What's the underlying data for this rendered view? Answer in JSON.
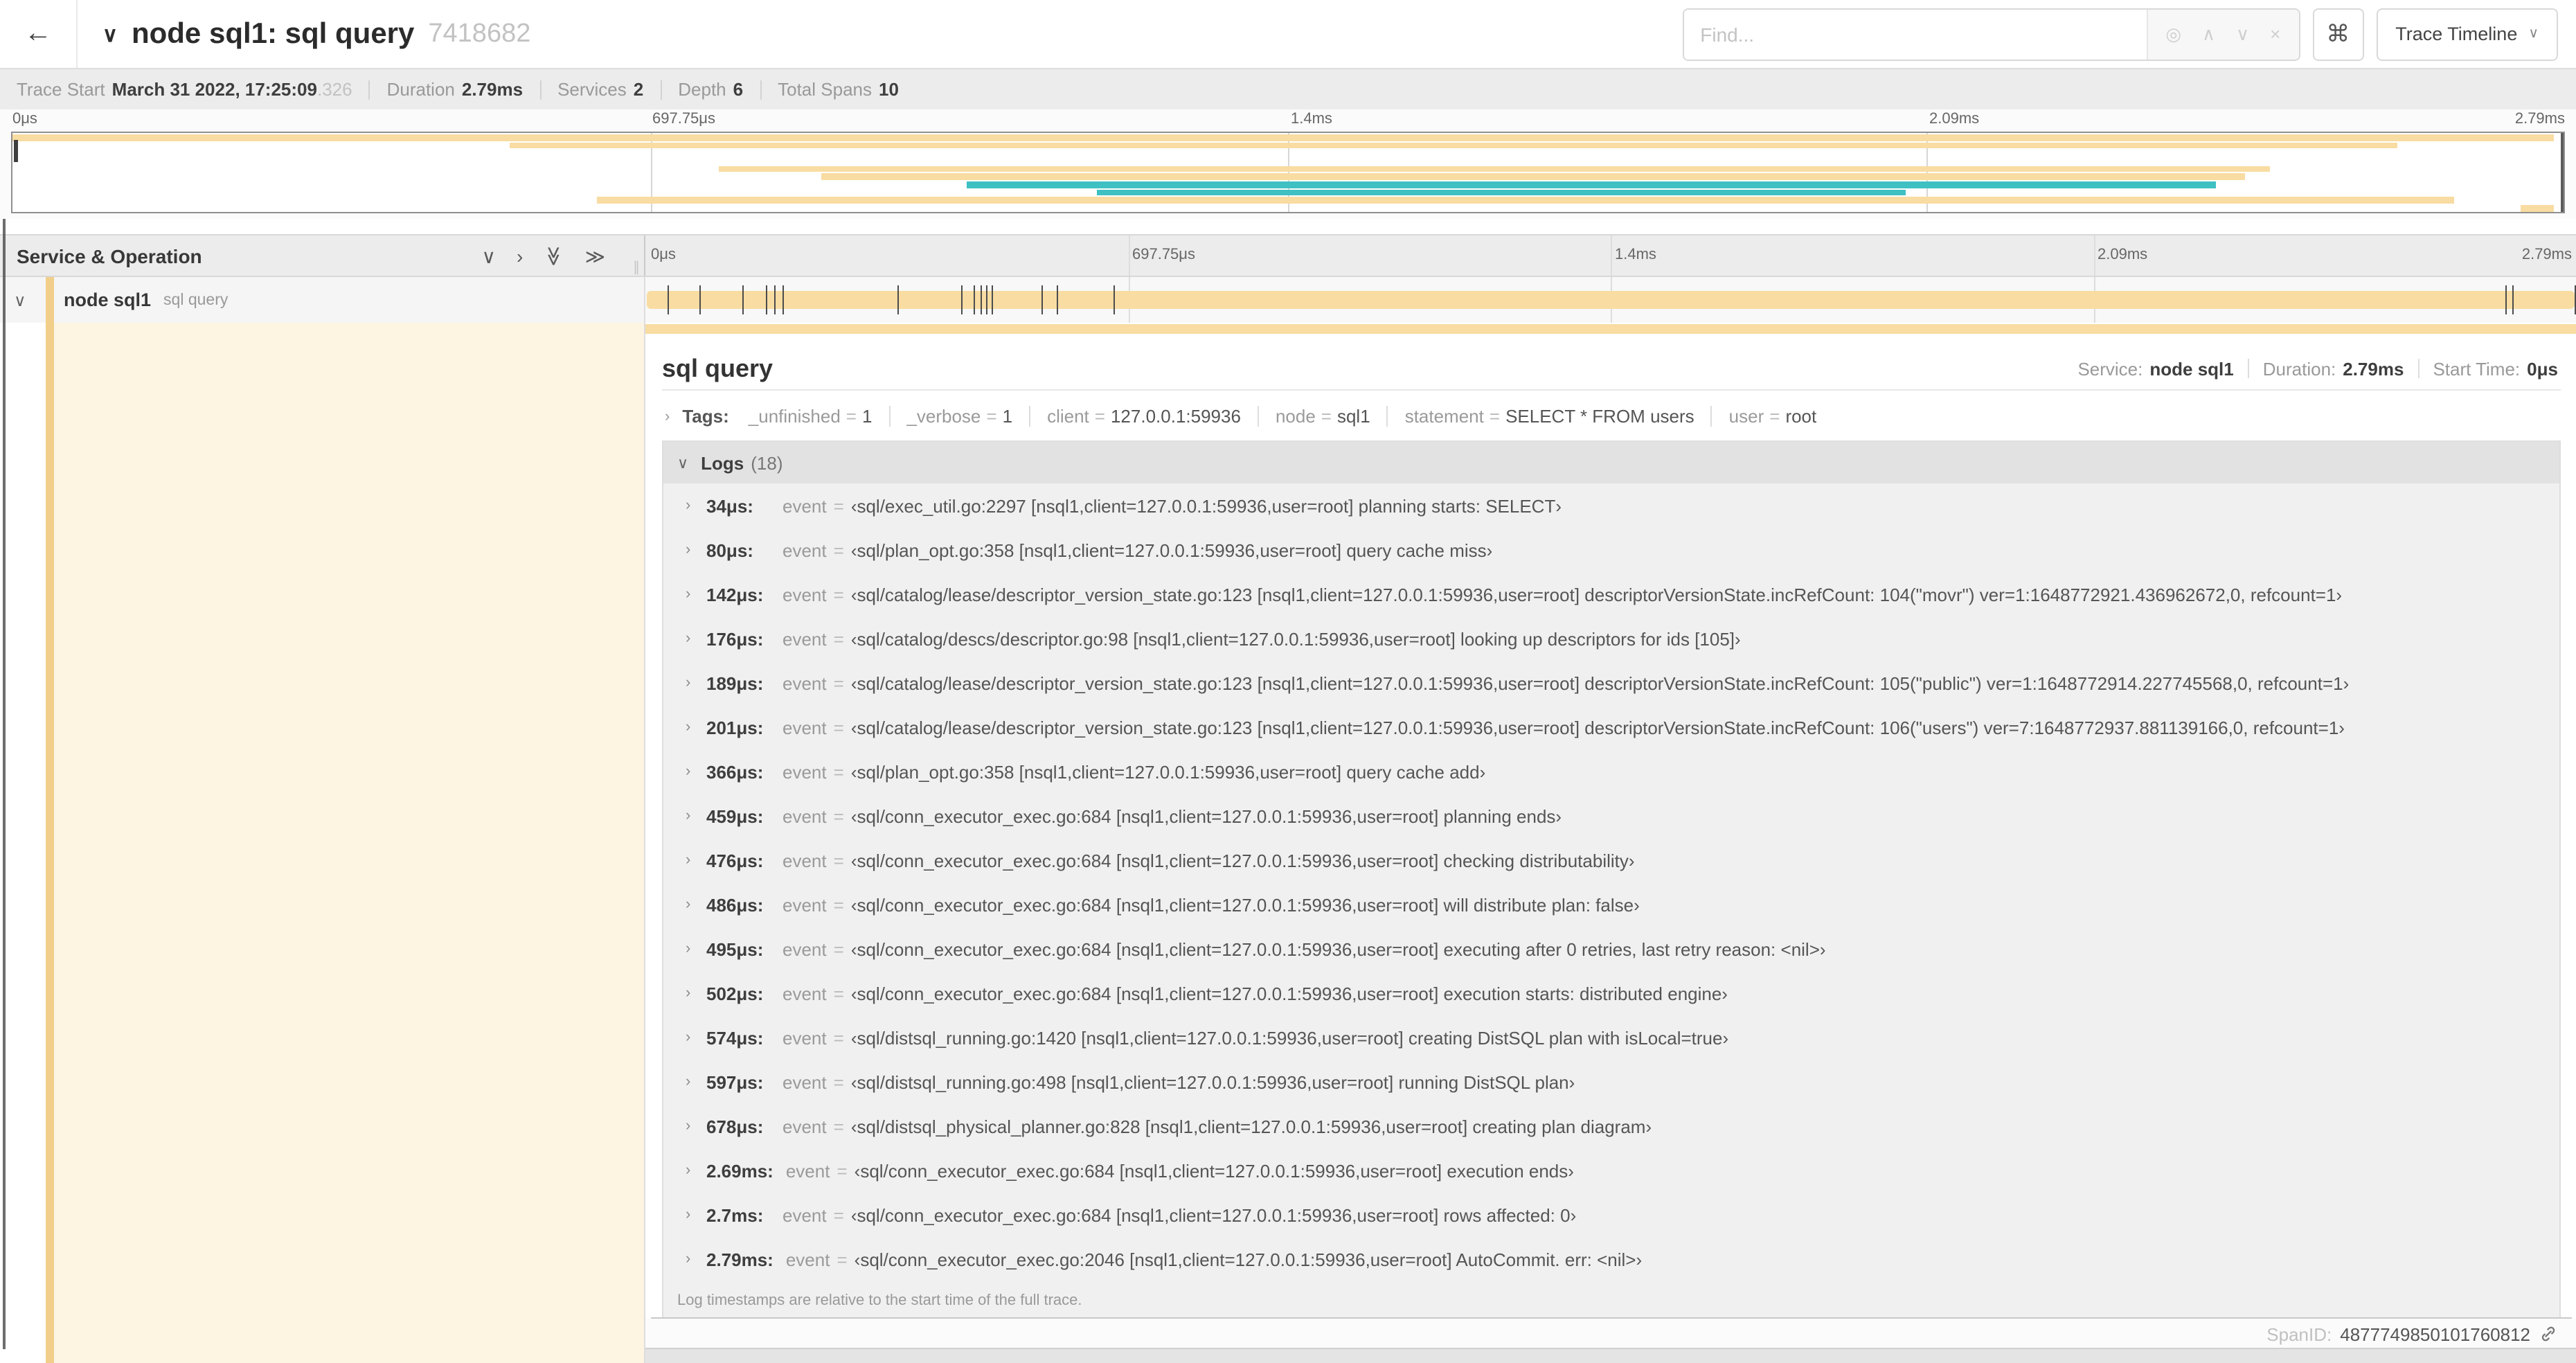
{
  "colors": {
    "span_bar": "#f8dca2",
    "span_accent": "#f1cf8b",
    "detail_bg": "#fdf5e2",
    "teal": "#3fc0c3"
  },
  "topbar": {
    "back_icon": "←",
    "collapse_icon": "∨",
    "title": "node sql1: sql query",
    "trace_id": "7418682",
    "find_placeholder": "Find...",
    "find_icons": [
      {
        "glyph": "◎",
        "name": "locate-icon"
      },
      {
        "glyph": "∧",
        "name": "find-prev-icon"
      },
      {
        "glyph": "∨",
        "name": "find-next-icon"
      },
      {
        "glyph": "×",
        "name": "clear-find-icon"
      }
    ],
    "keyboard_button": "⌘",
    "view_button": "Trace Timeline",
    "view_chevron": "∨"
  },
  "stats": [
    {
      "label": "Trace Start",
      "value": "March 31 2022, 17:25:09",
      "suffix": ".326"
    },
    {
      "label": "Duration",
      "value": "2.79ms"
    },
    {
      "label": "Services",
      "value": "2"
    },
    {
      "label": "Depth",
      "value": "6"
    },
    {
      "label": "Total Spans",
      "value": "10"
    }
  ],
  "ruler": [
    {
      "label": "0μs",
      "pct": 0
    },
    {
      "label": "697.75μs",
      "pct": 25
    },
    {
      "label": "1.4ms",
      "pct": 50
    },
    {
      "label": "2.09ms",
      "pct": 75
    },
    {
      "label": "2.79ms",
      "pct": 100
    }
  ],
  "trace": {
    "duration_us": 2791
  },
  "minimap": {
    "rows": 10,
    "bars": [
      {
        "row": 0,
        "start": 0,
        "end": 99.6,
        "color": "tan"
      },
      {
        "row": 1,
        "start": 19.5,
        "end": 93.5,
        "color": "tan"
      },
      {
        "row": 4,
        "start": 27.7,
        "end": 88.5,
        "color": "tan"
      },
      {
        "row": 5,
        "start": 31.7,
        "end": 87.5,
        "color": "tan"
      },
      {
        "row": 6,
        "start": 37.4,
        "end": 86.4,
        "color": "teal"
      },
      {
        "row": 7,
        "start": 42.5,
        "end": 74.2,
        "color": "teal"
      },
      {
        "row": 8,
        "start": 22.9,
        "end": 95.7,
        "color": "tan"
      },
      {
        "row": 9,
        "start": 98.3,
        "end": 99.6,
        "color": "tan"
      }
    ]
  },
  "timeline_header": {
    "label": "Service & Operation",
    "grip": "∥",
    "icons": [
      {
        "glyph": "∨",
        "name": "collapse-one-icon",
        "rotate": false
      },
      {
        "glyph": "›",
        "name": "expand-one-icon",
        "rotate": false
      },
      {
        "glyph": "≫",
        "name": "collapse-all-icon",
        "rotate": true
      },
      {
        "glyph": "≫",
        "name": "expand-all-icon",
        "rotate": false
      }
    ]
  },
  "span_row": {
    "chevron": "∨",
    "service": "node sql1",
    "operation": "sql query"
  },
  "detail": {
    "title": "sql query",
    "meta": [
      {
        "label": "Service:",
        "value": "node sql1"
      },
      {
        "label": "Duration:",
        "value": "2.79ms"
      },
      {
        "label": "Start Time:",
        "value": "0μs"
      }
    ],
    "tags_chevron": "›",
    "tags_label": "Tags:",
    "tags": [
      {
        "key": "_unfinished",
        "value": "1"
      },
      {
        "key": "_verbose",
        "value": "1"
      },
      {
        "key": "client",
        "value": "127.0.0.1:59936"
      },
      {
        "key": "node",
        "value": "sql1"
      },
      {
        "key": "statement",
        "value": "SELECT * FROM users"
      },
      {
        "key": "user",
        "value": "root"
      }
    ],
    "logs_chevron": "∨",
    "logs_label": "Logs",
    "logs_count": "(18)",
    "logs": [
      {
        "ts": "34μs:",
        "t_us": 34,
        "key": "event",
        "value": "‹sql/exec_util.go:2297 [nsql1,client=127.0.0.1:59936,user=root] planning starts: SELECT›"
      },
      {
        "ts": "80μs:",
        "t_us": 80,
        "key": "event",
        "value": "‹sql/plan_opt.go:358 [nsql1,client=127.0.0.1:59936,user=root] query cache miss›"
      },
      {
        "ts": "142μs:",
        "t_us": 142,
        "key": "event",
        "value": "‹sql/catalog/lease/descriptor_version_state.go:123 [nsql1,client=127.0.0.1:59936,user=root] descriptorVersionState.incRefCount: 104(\"movr\") ver=1:1648772921.436962672,0, refcount=1›"
      },
      {
        "ts": "176μs:",
        "t_us": 176,
        "key": "event",
        "value": "‹sql/catalog/descs/descriptor.go:98 [nsql1,client=127.0.0.1:59936,user=root] looking up descriptors for ids [105]›"
      },
      {
        "ts": "189μs:",
        "t_us": 189,
        "key": "event",
        "value": "‹sql/catalog/lease/descriptor_version_state.go:123 [nsql1,client=127.0.0.1:59936,user=root] descriptorVersionState.incRefCount: 105(\"public\") ver=1:1648772914.227745568,0, refcount=1›"
      },
      {
        "ts": "201μs:",
        "t_us": 201,
        "key": "event",
        "value": "‹sql/catalog/lease/descriptor_version_state.go:123 [nsql1,client=127.0.0.1:59936,user=root] descriptorVersionState.incRefCount: 106(\"users\") ver=7:1648772937.881139166,0, refcount=1›"
      },
      {
        "ts": "366μs:",
        "t_us": 366,
        "key": "event",
        "value": "‹sql/plan_opt.go:358 [nsql1,client=127.0.0.1:59936,user=root] query cache add›"
      },
      {
        "ts": "459μs:",
        "t_us": 459,
        "key": "event",
        "value": "‹sql/conn_executor_exec.go:684 [nsql1,client=127.0.0.1:59936,user=root] planning ends›"
      },
      {
        "ts": "476μs:",
        "t_us": 476,
        "key": "event",
        "value": "‹sql/conn_executor_exec.go:684 [nsql1,client=127.0.0.1:59936,user=root] checking distributability›"
      },
      {
        "ts": "486μs:",
        "t_us": 486,
        "key": "event",
        "value": "‹sql/conn_executor_exec.go:684 [nsql1,client=127.0.0.1:59936,user=root] will distribute plan: false›"
      },
      {
        "ts": "495μs:",
        "t_us": 495,
        "key": "event",
        "value": "‹sql/conn_executor_exec.go:684 [nsql1,client=127.0.0.1:59936,user=root] executing after 0 retries, last retry reason: <nil>›"
      },
      {
        "ts": "502μs:",
        "t_us": 502,
        "key": "event",
        "value": "‹sql/conn_executor_exec.go:684 [nsql1,client=127.0.0.1:59936,user=root] execution starts: distributed engine›"
      },
      {
        "ts": "574μs:",
        "t_us": 574,
        "key": "event",
        "value": "‹sql/distsql_running.go:1420 [nsql1,client=127.0.0.1:59936,user=root] creating DistSQL plan with isLocal=true›"
      },
      {
        "ts": "597μs:",
        "t_us": 597,
        "key": "event",
        "value": "‹sql/distsql_running.go:498 [nsql1,client=127.0.0.1:59936,user=root] running DistSQL plan›"
      },
      {
        "ts": "678μs:",
        "t_us": 678,
        "key": "event",
        "value": "‹sql/distsql_physical_planner.go:828 [nsql1,client=127.0.0.1:59936,user=root] creating plan diagram›"
      },
      {
        "ts": "2.69ms:",
        "t_us": 2690,
        "key": "event",
        "value": "‹sql/conn_executor_exec.go:684 [nsql1,client=127.0.0.1:59936,user=root] execution ends›"
      },
      {
        "ts": "2.7ms:",
        "t_us": 2700,
        "key": "event",
        "value": "‹sql/conn_executor_exec.go:684 [nsql1,client=127.0.0.1:59936,user=root] rows affected: 0›"
      },
      {
        "ts": "2.79ms:",
        "t_us": 2790,
        "key": "event",
        "value": "‹sql/conn_executor_exec.go:2046 [nsql1,client=127.0.0.1:59936,user=root] AutoCommit. err: <nil>›"
      }
    ],
    "note": "Log timestamps are relative to the start time of the full trace.",
    "spanid_label": "SpanID:",
    "spanid": "4877749850101760812"
  }
}
